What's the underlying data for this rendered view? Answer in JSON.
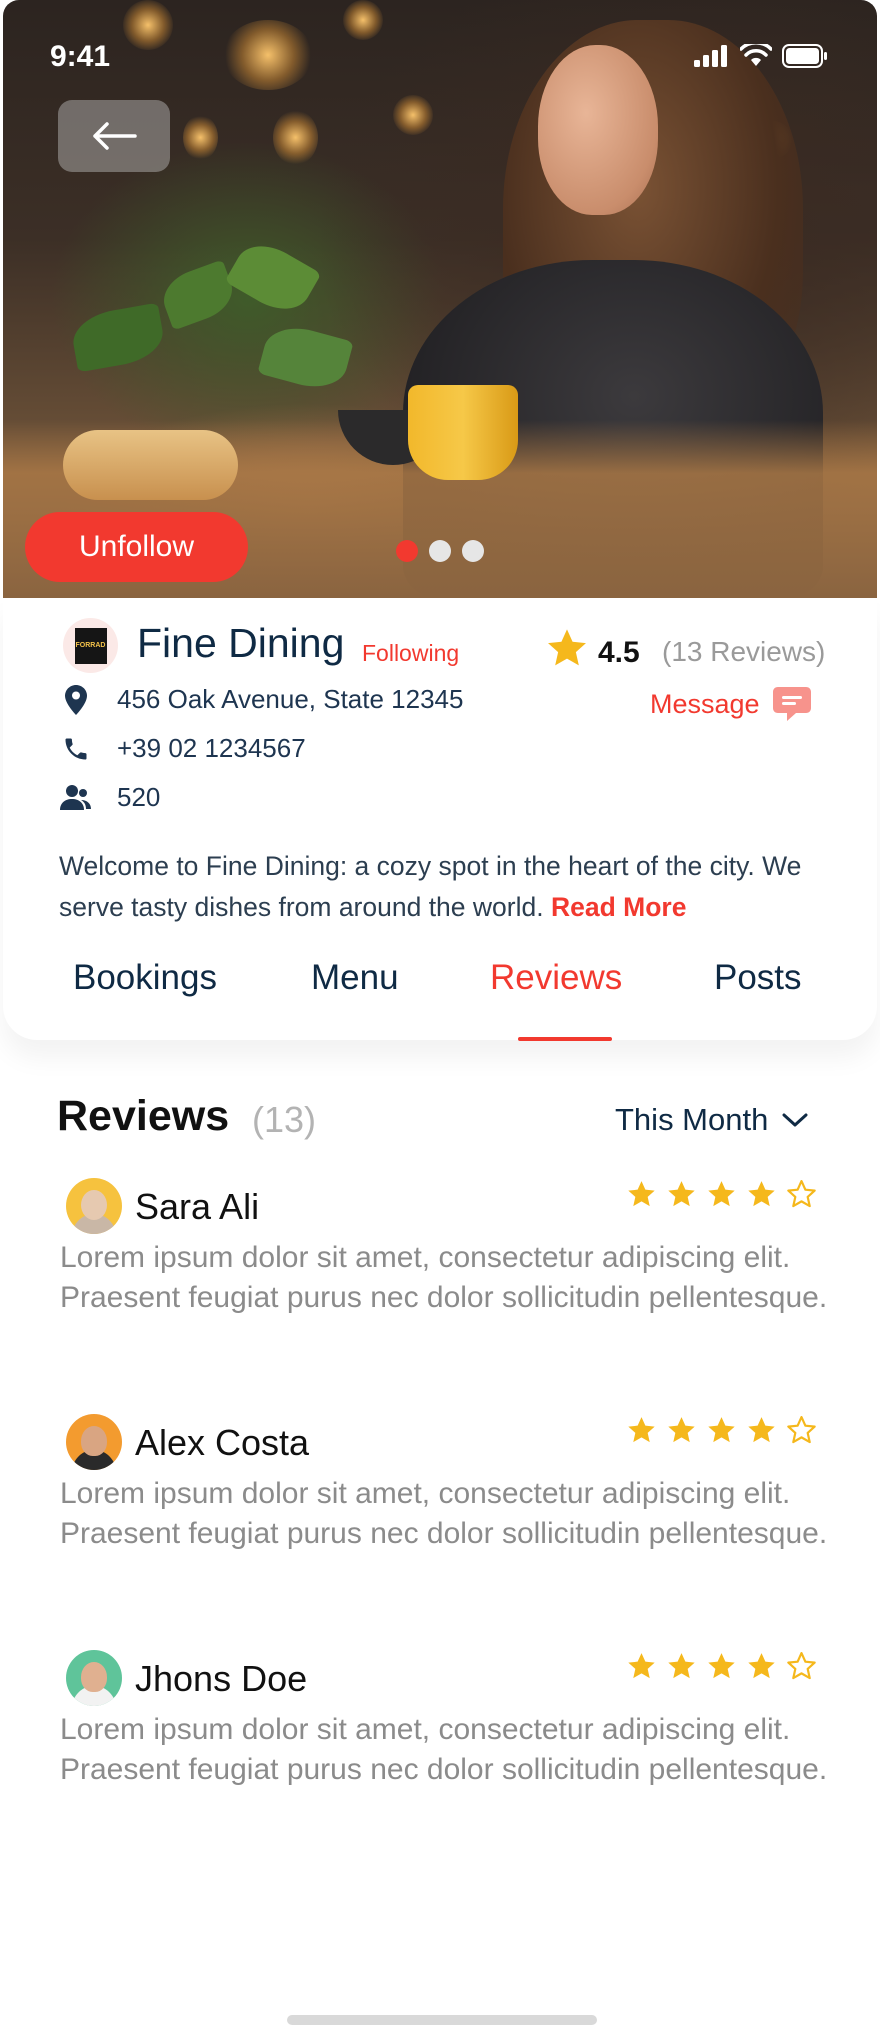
{
  "status_bar": {
    "time": "9:41"
  },
  "hero": {
    "unfollow_label": "Unfollow",
    "slide_count": 3,
    "active_slide": 1
  },
  "restaurant": {
    "logo_text": "FORRAD",
    "name": "Fine Dining",
    "follow_status": "Following",
    "rating": "4.5",
    "reviews_count_label": "(13 Reviews)",
    "address": "456 Oak Avenue, State 12345",
    "phone": "+39 02 1234567",
    "followers": "520",
    "message_label": "Message",
    "description": "Welcome to Fine Dining: a cozy spot in the heart of the city. We serve tasty dishes from around the world. ",
    "read_more": "Read More"
  },
  "tabs": [
    {
      "label": "Bookings",
      "active": false
    },
    {
      "label": "Menu",
      "active": false
    },
    {
      "label": "Reviews",
      "active": true
    },
    {
      "label": "Posts",
      "active": false
    }
  ],
  "reviews_section": {
    "title": "Reviews",
    "count": "(13)",
    "filter": "This Month",
    "items": [
      {
        "name": "Sara Ali",
        "rating": 4,
        "max_rating": 5,
        "text": "Lorem ipsum dolor sit amet, consectetur adipiscing elit. Praesent feugiat purus nec dolor sollicitudin pellentesque.",
        "avatar_bg": "#f6c23e"
      },
      {
        "name": "Alex Costa",
        "rating": 4,
        "max_rating": 5,
        "text": "Lorem ipsum dolor sit amet, consectetur adipiscing elit. Praesent feugiat purus nec dolor sollicitudin pellentesque.",
        "avatar_bg": "#f39b2f"
      },
      {
        "name": "Jhons Doe",
        "rating": 4,
        "max_rating": 5,
        "text": "Lorem ipsum dolor sit amet, consectetur adipiscing elit. Praesent feugiat purus nec dolor sollicitudin pellentesque.",
        "avatar_bg": "#5fc49a"
      }
    ]
  },
  "colors": {
    "accent": "#f2392f",
    "star": "#f5b81c",
    "text_dark": "#0f2a44",
    "text_muted": "#8b8b8b"
  },
  "icons": [
    "back-arrow-icon",
    "signal-icon",
    "wifi-icon",
    "battery-icon",
    "location-pin-icon",
    "phone-icon",
    "users-icon",
    "star-icon",
    "message-icon",
    "chevron-down-icon"
  ]
}
